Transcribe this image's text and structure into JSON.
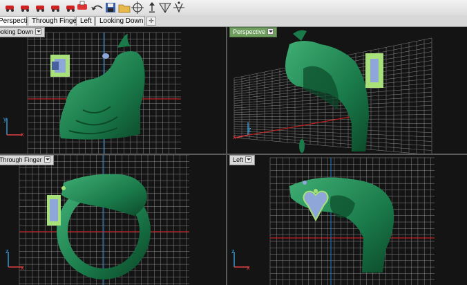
{
  "toolbar": {
    "icons": [
      "car-red-icon",
      "car-red-icon",
      "car-red-icon",
      "car-red-icon",
      "car-red-icon",
      "car-select-icon",
      "undo-icon",
      "save-icon",
      "folder-icon",
      "crosshair-icon",
      "arrow-up-icon",
      "pyramid-icon",
      "mirror-icon"
    ]
  },
  "tabs": [
    {
      "label": "Perspective",
      "active": true
    },
    {
      "label": "Through Finger",
      "active": false
    },
    {
      "label": "Left",
      "active": false
    },
    {
      "label": "Looking Down",
      "active": false
    }
  ],
  "viewports": {
    "top_left": {
      "label": "Looking Down",
      "active": false
    },
    "top_right": {
      "label": "Perspective",
      "active": true
    },
    "bottom_left": {
      "label": "Through Finger",
      "active": false
    },
    "bottom_right": {
      "label": "Left",
      "active": false
    }
  },
  "axes": {
    "x": "x",
    "y": "y",
    "z": "z"
  },
  "colors": {
    "model": "#1a7a4a",
    "model_dark": "#0c4a2a",
    "model_light": "#3fae74",
    "gem": "#8fa6d8",
    "prongs": "#a8e07a",
    "grid": "#8a8a8a",
    "grid_red": "#c02020",
    "grid_blue": "#1e6fb0",
    "active_label": "#6f9e5f"
  }
}
